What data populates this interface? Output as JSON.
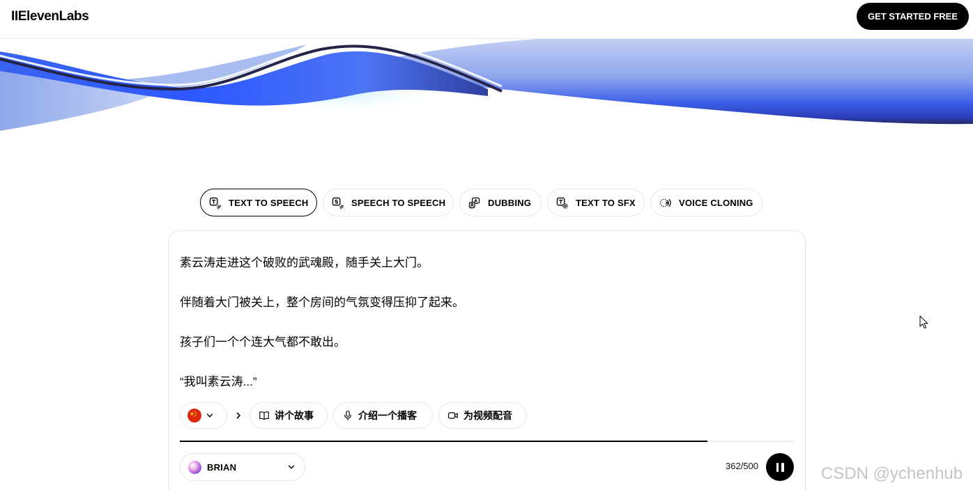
{
  "header": {
    "logo_text": "IIElevenLabs",
    "cta_label": "GET STARTED FREE"
  },
  "tabs": [
    {
      "label": "TEXT TO SPEECH",
      "icon": "text-to-speech-icon",
      "active": true
    },
    {
      "label": "SPEECH TO SPEECH",
      "icon": "speech-to-speech-icon",
      "active": false
    },
    {
      "label": "DUBBING",
      "icon": "dubbing-icon",
      "active": false
    },
    {
      "label": "TEXT TO SFX",
      "icon": "text-to-sfx-icon",
      "active": false
    },
    {
      "label": "VOICE CLONING",
      "icon": "voice-cloning-icon",
      "active": false
    }
  ],
  "editor": {
    "paragraphs": [
      "素云涛走进这个破败的武魂殿，随手关上大门。",
      "伴随着大门被关上，整个房间的气氛变得压抑了起来。",
      "孩子们一个个连大气都不敢出。",
      "“我叫素云涛...”"
    ],
    "language": {
      "icon": "china-flag-icon",
      "dropdown_icon": "chevron-down-icon"
    },
    "more_icon": "chevron-right-icon",
    "suggestions": [
      {
        "label": "讲个故事",
        "icon": "book-icon"
      },
      {
        "label": "介绍一个播客",
        "icon": "microphone-icon"
      },
      {
        "label": "为视频配音",
        "icon": "video-icon"
      }
    ],
    "playback_progress": 0.86,
    "voice": {
      "name": "BRIAN",
      "icon": "voice-avatar-icon"
    },
    "char_count": "362/500",
    "play_control_icon": "pause-icon"
  },
  "watermark": "CSDN @ychenhub",
  "colors": {
    "cta_background": "#000000",
    "cta_text": "#ffffff",
    "border": "#e5e5e5",
    "wave_blue": "#2f58f2",
    "wave_navy": "#262a66",
    "flag_red": "#de2910",
    "flag_yellow": "#ffde00"
  }
}
